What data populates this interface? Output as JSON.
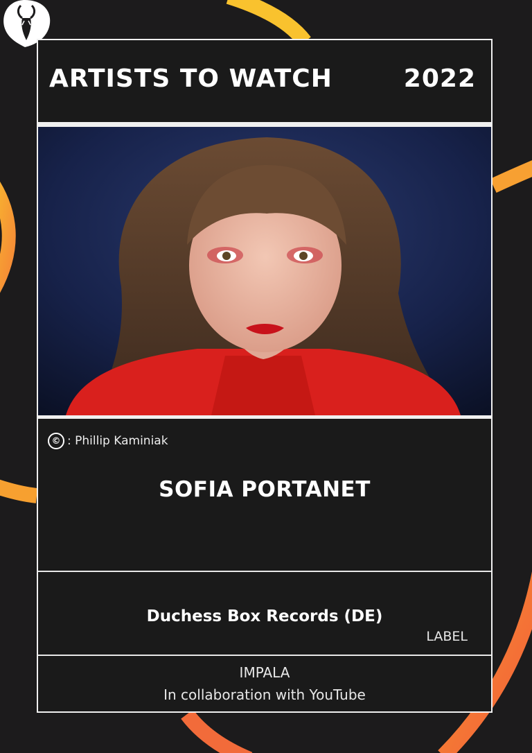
{
  "header": {
    "title": "ARTISTS TO WATCH",
    "year": "2022"
  },
  "photo": {
    "credit_symbol": "©",
    "credit_text": ": Phillip Kaminiak"
  },
  "artist": {
    "name": "SOFIA PORTANET"
  },
  "label": {
    "name": "Duchess Box Records (DE)",
    "tag": "LABEL"
  },
  "footer": {
    "org": "IMPALA",
    "collab": "In collaboration with YouTube"
  },
  "colors": {
    "background": "#1c1b1c",
    "arc_yellow": "#f7bd2e",
    "arc_orange": "#f4743b",
    "frame": "#f0f0f0"
  },
  "icons": {
    "logo": "antelope-logo-icon",
    "copyright": "copyright-icon"
  }
}
